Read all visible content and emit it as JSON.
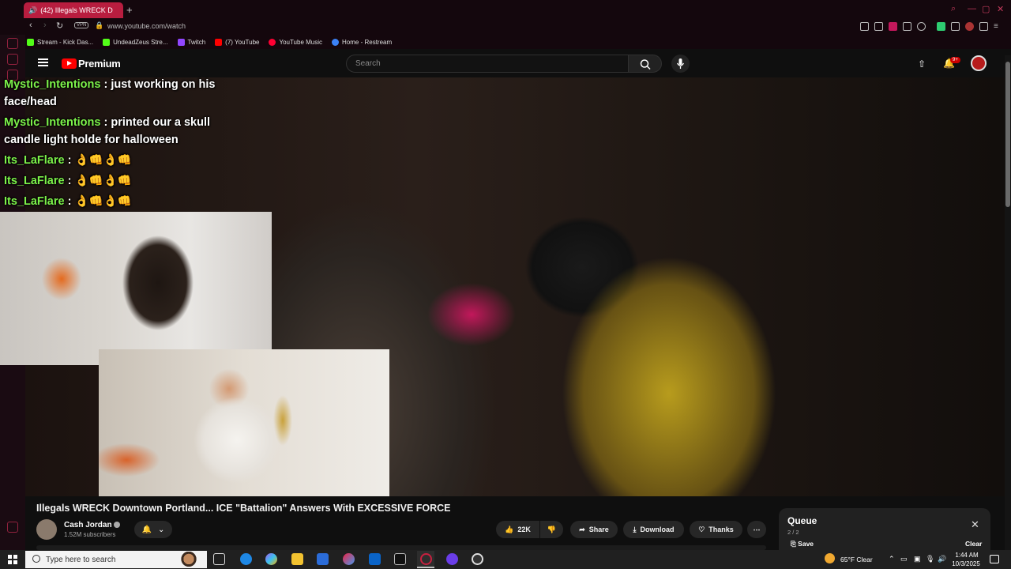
{
  "browser": {
    "tab_title": "(42) Illegals WRECK D",
    "url": "www.youtube.com/watch",
    "vpn_label": "VPN",
    "bookmarks": [
      {
        "label": "Stream - Kick Das...",
        "color": "#53fc18"
      },
      {
        "label": "UndeadZeus Stre...",
        "color": "#53fc18"
      },
      {
        "label": "Twitch",
        "color": "#9146ff"
      },
      {
        "label": "(7) YouTube",
        "color": "#ff0000"
      },
      {
        "label": "YouTube Music",
        "color": "#ff0033"
      },
      {
        "label": "Home - Restream",
        "color": "#3b82f6"
      }
    ]
  },
  "youtube": {
    "logo_text": "Premium",
    "search_placeholder": "Search",
    "notification_count": "9+"
  },
  "chat": [
    {
      "user": "Mystic_Intentions",
      "message": " : just working on his face/head"
    },
    {
      "user": "Mystic_Intentions",
      "message": " : printed our a skull candle light holde for halloween"
    },
    {
      "user": "Its_LaFlare",
      "message": " : 👌👊👌👊"
    },
    {
      "user": "Its_LaFlare",
      "message": " : 👌👊👌👊"
    },
    {
      "user": "Its_LaFlare",
      "message": " : 👌👊👌👊"
    }
  ],
  "video": {
    "title": "Illegals WRECK Downtown Portland... ICE \"Battalion\" Answers With EXCESSIVE FORCE",
    "channel": "Cash Jordan",
    "subscribers": "1.52M subscribers",
    "likes": "22K",
    "share_label": "Share",
    "download_label": "Download",
    "thanks_label": "Thanks",
    "more_label": "⋯"
  },
  "queue": {
    "title": "Queue",
    "count": "2 / 2",
    "save_label": "Save",
    "clear_label": "Clear"
  },
  "taskbar": {
    "search_placeholder": "Type here to search",
    "weather": "65°F  Clear",
    "time": "1:44 AM",
    "date": "10/3/2025"
  },
  "colors": {
    "accent": "#b81d3f",
    "chat_username": "#7cf24a",
    "youtube_red": "#ff0000"
  }
}
